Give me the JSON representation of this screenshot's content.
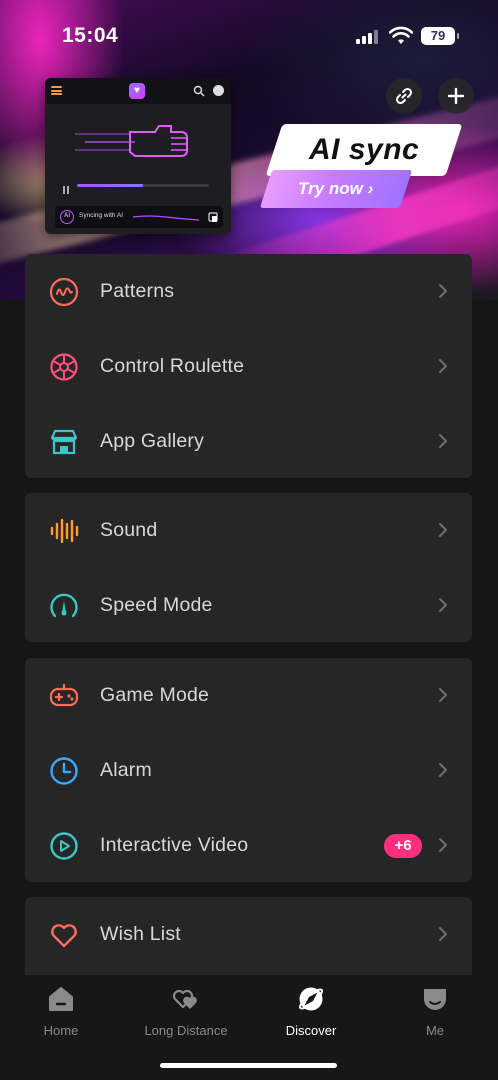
{
  "status_bar": {
    "time": "15:04",
    "battery": "79"
  },
  "banner": {
    "mini_preview": {
      "sync_text": "Syncing with AI",
      "ai_badge": "AI"
    },
    "headline": "AI sync",
    "cta": "Try now ›"
  },
  "menu_groups": [
    {
      "items": [
        {
          "label": "Patterns",
          "icon": "patterns-icon",
          "color": "#ff6b5a"
        },
        {
          "label": "Control Roulette",
          "icon": "roulette-icon",
          "color": "#ff4f7d"
        },
        {
          "label": "App Gallery",
          "icon": "gallery-icon",
          "color": "#3cc6c8"
        }
      ]
    },
    {
      "items": [
        {
          "label": "Sound",
          "icon": "sound-icon",
          "color": "#ff9a2e"
        },
        {
          "label": "Speed Mode",
          "icon": "speed-icon",
          "color": "#3cc6c8"
        }
      ]
    },
    {
      "items": [
        {
          "label": "Game Mode",
          "icon": "gamepad-icon",
          "color": "#ff6b5a"
        },
        {
          "label": "Alarm",
          "icon": "alarm-icon",
          "color": "#3aa7ff"
        },
        {
          "label": "Interactive Video",
          "icon": "play-icon",
          "color": "#3cc6c8",
          "badge": "+6"
        }
      ]
    },
    {
      "items": [
        {
          "label": "Wish List",
          "icon": "heart-icon",
          "color": "#ff6b5a"
        }
      ]
    }
  ],
  "tabs": [
    {
      "label": "Home",
      "active": false
    },
    {
      "label": "Long Distance",
      "active": false
    },
    {
      "label": "Discover",
      "active": true
    },
    {
      "label": "Me",
      "active": false
    }
  ]
}
